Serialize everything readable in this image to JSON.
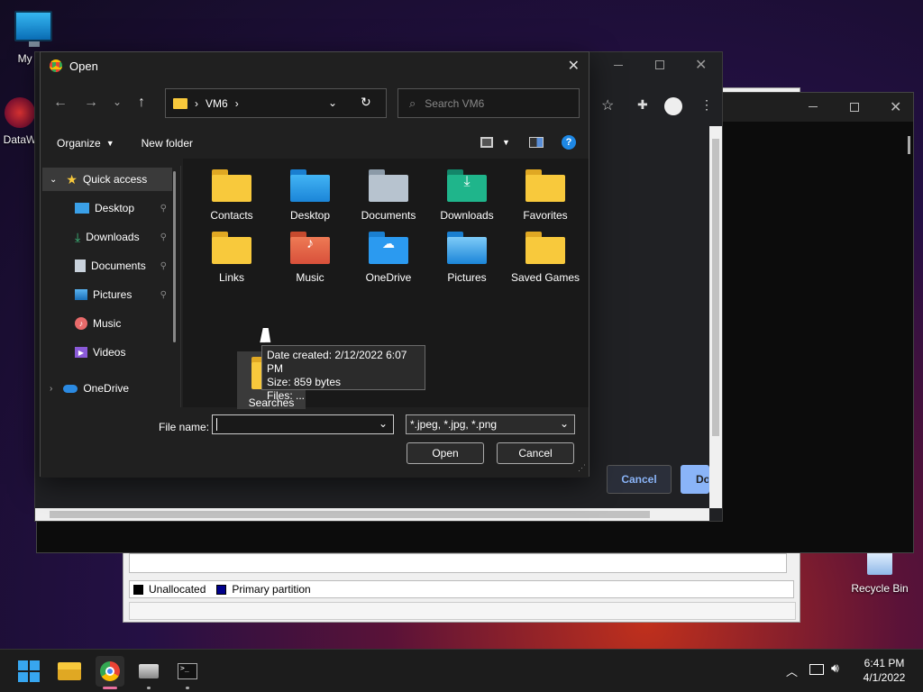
{
  "desktop": {
    "icons": [
      {
        "label": "My Co"
      },
      {
        "label": "DataW"
      },
      {
        "label": "Recycle Bin"
      }
    ]
  },
  "disk_mgmt": {
    "legend": [
      "Unallocated",
      "Primary partition"
    ]
  },
  "browser": {
    "cancel_label": "Cancel",
    "done_label": "Do"
  },
  "dialog": {
    "title": "Open",
    "address": {
      "folder": "VM6"
    },
    "search_placeholder": "Search VM6",
    "toolbar": {
      "organize": "Organize",
      "new_folder": "New folder"
    },
    "nav": {
      "quick_access": "Quick access",
      "items": [
        "Desktop",
        "Downloads",
        "Documents",
        "Pictures",
        "Music",
        "Videos"
      ],
      "onedrive": "OneDrive"
    },
    "folders": [
      "Contacts",
      "Desktop",
      "Documents",
      "Downloads",
      "Favorites",
      "Links",
      "Music",
      "OneDrive",
      "Pictures",
      "Saved Games",
      "Searches",
      ""
    ],
    "tooltip": {
      "line1": "Date created: 2/12/2022 6:07 PM",
      "line2": "Size: 859 bytes",
      "line3": "Files: ..."
    },
    "filename_label": "File name:",
    "filename_value": "",
    "filetype": "*.jpeg, *.jpg, *.png",
    "open_label": "Open",
    "cancel_label": "Cancel"
  },
  "taskbar": {
    "time": "6:41 PM",
    "date": "4/1/2022"
  },
  "colors": {
    "accent": "#0078d4",
    "folder_yellow": "#f8c93c"
  }
}
